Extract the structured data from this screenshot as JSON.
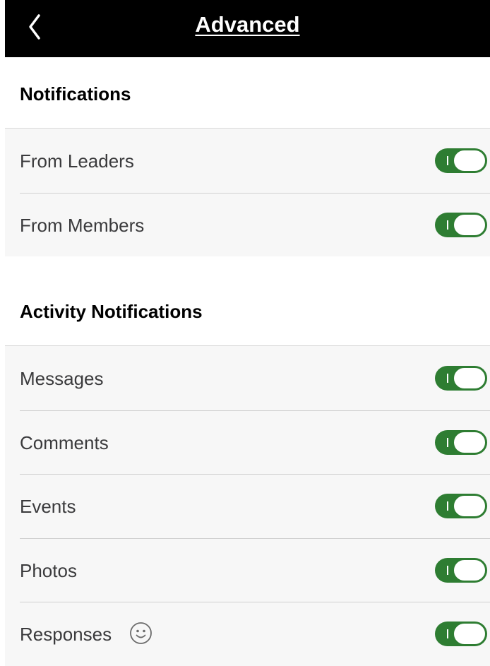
{
  "header": {
    "title": "Advanced",
    "back_icon": "chevron-left-icon"
  },
  "sections": [
    {
      "title": "Notifications",
      "items": [
        {
          "label": "From Leaders",
          "enabled": true
        },
        {
          "label": "From Members",
          "enabled": true
        }
      ]
    },
    {
      "title": "Activity Notifications",
      "items": [
        {
          "label": "Messages",
          "enabled": true
        },
        {
          "label": "Comments",
          "enabled": true
        },
        {
          "label": "Events",
          "enabled": true
        },
        {
          "label": "Photos",
          "enabled": true
        },
        {
          "label": "Responses",
          "enabled": true,
          "icon": "smiley-face-icon"
        }
      ]
    }
  ],
  "colors": {
    "header_bg": "#000000",
    "toggle_on": "#2e7d32",
    "row_bg": "#f7f7f7"
  }
}
